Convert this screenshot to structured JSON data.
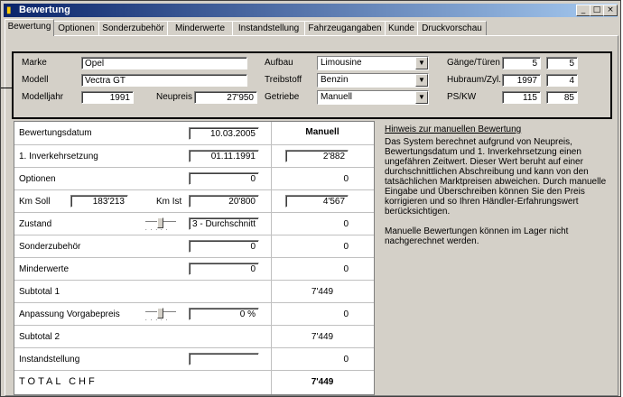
{
  "window": {
    "title": "Bewertung",
    "min": "_",
    "max": "□",
    "close": "×"
  },
  "tabs": [
    "Bewertung",
    "Optionen",
    "Sonderzubehör",
    "Minderwerte",
    "Instandstellung",
    "Fahrzeugangaben",
    "Kunde",
    "Druckvorschau"
  ],
  "vehicle": {
    "marke_label": "Marke",
    "marke": "Opel",
    "modell_label": "Modell",
    "modell": "Vectra GT",
    "modelljahr_label": "Modelljahr",
    "modelljahr": "1991",
    "neupreis_label": "Neupreis",
    "neupreis": "27'950",
    "aufbau_label": "Aufbau",
    "aufbau": "Limousine",
    "treibstoff_label": "Treibstoff",
    "treibstoff": "Benzin",
    "getriebe_label": "Getriebe",
    "getriebe": "Manuell",
    "gaenge_label": "Gänge/Türen",
    "gaenge": "5",
    "tueren": "5",
    "hubraum_label": "Hubraum/Zyl.",
    "hubraum": "1997",
    "zyl": "4",
    "ps_label": "PS/KW",
    "ps": "115",
    "kw": "85"
  },
  "grid": {
    "header": "Manuell",
    "bewertungsdatum_label": "Bewertungsdatum",
    "bewertungsdatum": "10.03.2005",
    "inverkehr_label": "1. Inverkehrsetzung",
    "inverkehr": "01.11.1991",
    "inverkehr_val": "2'882",
    "optionen_label": "Optionen",
    "optionen": "0",
    "optionen_val": "0",
    "kmsoll_label": "Km Soll",
    "kmsoll": "183'213",
    "kmist_label": "Km Ist",
    "kmist": "20'800",
    "km_val": "4'567",
    "zustand_label": "Zustand",
    "zustand": "3 - Durchschnitt",
    "zustand_val": "0",
    "sonder_label": "Sonderzubehör",
    "sonder": "0",
    "sonder_val": "0",
    "minder_label": "Minderwerte",
    "minder": "0",
    "minder_val": "0",
    "subtotal1_label": "Subtotal 1",
    "subtotal1": "7'449",
    "anpassung_label": "Anpassung Vorgabepreis",
    "anpassung": "0 %",
    "anpassung_val": "0",
    "subtotal2_label": "Subtotal 2",
    "subtotal2": "7'449",
    "instand_label": "Instandstellung",
    "instand": "",
    "instand_val": "0",
    "total_label": "TOTAL CHF",
    "total": "7'449"
  },
  "hint": {
    "title": "Hinweis zur manuellen Bewertung",
    "p1": "Das System berechnet aufgrund von Neupreis, Bewertungsdatum und 1. Inverkehrsetzung einen ungefähren Zeitwert. Dieser Wert beruht auf einer durchschnittlichen Abschreibung und kann von den tatsächlichen Marktpreisen abweichen. Durch manuelle Eingabe und Überschreiben können Sie den Preis korrigieren und so Ihren Händler-Erfahrungswert berücksichtigen.",
    "p2": "Manuelle Bewertungen können im Lager nicht nachgerechnet werden."
  }
}
